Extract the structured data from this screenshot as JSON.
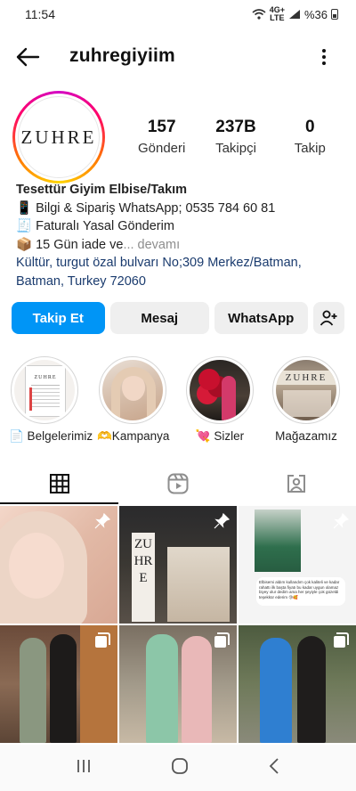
{
  "status_bar": {
    "time": "11:54",
    "battery": "%36",
    "network": "4G+",
    "network_sub": "LTE"
  },
  "header": {
    "username": "zuhregiyiim"
  },
  "profile": {
    "avatar_text": "ZUHRE",
    "stats": [
      {
        "value": "157",
        "label": "Gönderi"
      },
      {
        "value": "237B",
        "label": "Takipçi"
      },
      {
        "value": "0",
        "label": "Takip"
      }
    ],
    "bio": {
      "name": "Tesettür Giyim Elbise/Takım",
      "line1": "📱 Bilgi & Sipariş WhatsApp; 0535 784 60 81",
      "line2": "🧾 Faturalı Yasal Gönderim",
      "line3": "📦 15 Gün iade ve",
      "line3_more": "... devamı",
      "address": "Kültür, turgut özal bulvarı No;309 Merkez/Batman, Batman, Turkey 72060"
    }
  },
  "actions": {
    "follow": "Takip Et",
    "message": "Mesaj",
    "whatsapp": "WhatsApp"
  },
  "highlights": [
    {
      "label": "📄 Belgelerimiz"
    },
    {
      "label": "🫶Kampanya"
    },
    {
      "label": "💘 Sizler"
    },
    {
      "label": "Mağazamız"
    }
  ],
  "highlight_doc_title": "ZUHRE",
  "highlight_store_sign": "ZUHRE",
  "grid_store_sign": "ZUHRE",
  "grid_chat": "Elbisemi aldım kullandım çok kaliteli ve kadar rahattı ilk başta fiyatı bu kadar uygun olamaz biyey olur dedim ama her şeyiyle çok güzeldi teşekkür ederim 😘🥰",
  "colors": {
    "accent": "#0095f6",
    "text": "#262626",
    "link": "#1a3b6e"
  },
  "icons": [
    "arrow-left-icon",
    "more-vertical-icon",
    "add-user-icon",
    "grid-icon",
    "reels-icon",
    "tagged-icon",
    "pin-icon",
    "multi-photo-icon"
  ]
}
